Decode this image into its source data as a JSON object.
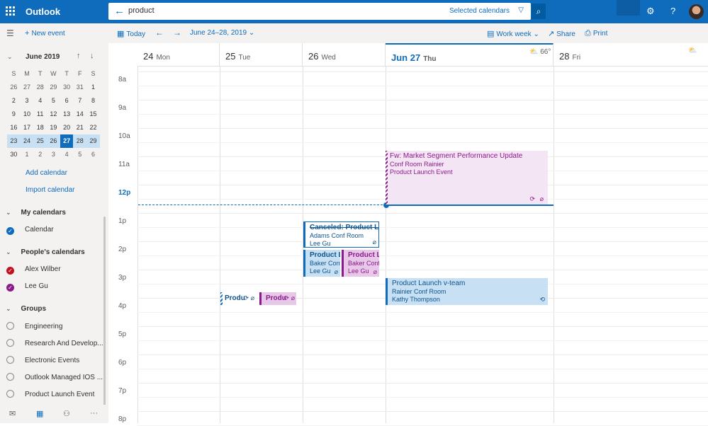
{
  "app": {
    "title": "Outlook"
  },
  "search": {
    "query": "product",
    "scope": "Selected calendars"
  },
  "toolbar": {
    "new_event": "New event",
    "today": "Today",
    "date_range": "June 24–28, 2019",
    "view": "Work week",
    "share": "Share",
    "print": "Print"
  },
  "mini_calendar": {
    "month": "June 2019",
    "weekdays": [
      "S",
      "M",
      "T",
      "W",
      "T",
      "F",
      "S"
    ],
    "weeks": [
      [
        "26",
        "27",
        "28",
        "29",
        "30",
        "31",
        "1"
      ],
      [
        "2",
        "3",
        "4",
        "5",
        "6",
        "7",
        "8"
      ],
      [
        "9",
        "10",
        "11",
        "12",
        "13",
        "14",
        "15"
      ],
      [
        "16",
        "17",
        "18",
        "19",
        "20",
        "21",
        "22"
      ],
      [
        "23",
        "24",
        "25",
        "26",
        "27",
        "28",
        "29"
      ],
      [
        "30",
        "1",
        "2",
        "3",
        "4",
        "5",
        "6"
      ]
    ],
    "today": "27"
  },
  "sidebar": {
    "add_calendar": "Add calendar",
    "import_calendar": "Import calendar",
    "my_calendars": {
      "label": "My calendars",
      "items": [
        {
          "label": "Calendar",
          "color": "#0f6cbd"
        }
      ]
    },
    "peoples_calendars": {
      "label": "People's calendars",
      "items": [
        {
          "label": "Alex Wilber",
          "color": "#c50f1f"
        },
        {
          "label": "Lee Gu",
          "color": "#8b1a8b"
        }
      ]
    },
    "groups": {
      "label": "Groups",
      "items": [
        {
          "label": "Engineering"
        },
        {
          "label": "Research And Develop..."
        },
        {
          "label": "Electronic Events"
        },
        {
          "label": "Outlook Managed IOS ..."
        },
        {
          "label": "Product Launch Event"
        }
      ]
    }
  },
  "days": [
    {
      "num": "24",
      "name": "Mon"
    },
    {
      "num": "25",
      "name": "Tue"
    },
    {
      "num": "26",
      "name": "Wed"
    },
    {
      "num": "Jun 27",
      "name": "Thu"
    },
    {
      "num": "28",
      "name": "Fri"
    }
  ],
  "weather": {
    "thu": "66°"
  },
  "hours": [
    "8a",
    "9a",
    "10a",
    "11a",
    "12p",
    "1p",
    "2p",
    "3p",
    "4p",
    "5p",
    "6p",
    "7p",
    "8p"
  ],
  "events": {
    "market": {
      "title": "Fw: Market Segment Performance Update",
      "location": "Conf Room Rainier",
      "calendar": "Product Launch Event"
    },
    "canceled": {
      "title": "Canceled: Product Laun",
      "location": "Adams Conf Room",
      "organizer": "Lee Gu"
    },
    "wed_blue": {
      "title": "Product La",
      "location": "Baker Conf R",
      "organizer": "Lee Gu"
    },
    "wed_purple": {
      "title": "Product La",
      "location": "Baker Conf R",
      "organizer": "Lee Gu"
    },
    "vteam": {
      "title": "Product Launch v-team",
      "location": "Rainier Conf Room",
      "organizer": "Kathy Thompson"
    },
    "tue_blue": {
      "title": "Produ"
    },
    "tue_purple": {
      "title": "Produ"
    }
  },
  "colors": {
    "accent": "#0f6cbd",
    "purple": "#8b1a8b"
  }
}
